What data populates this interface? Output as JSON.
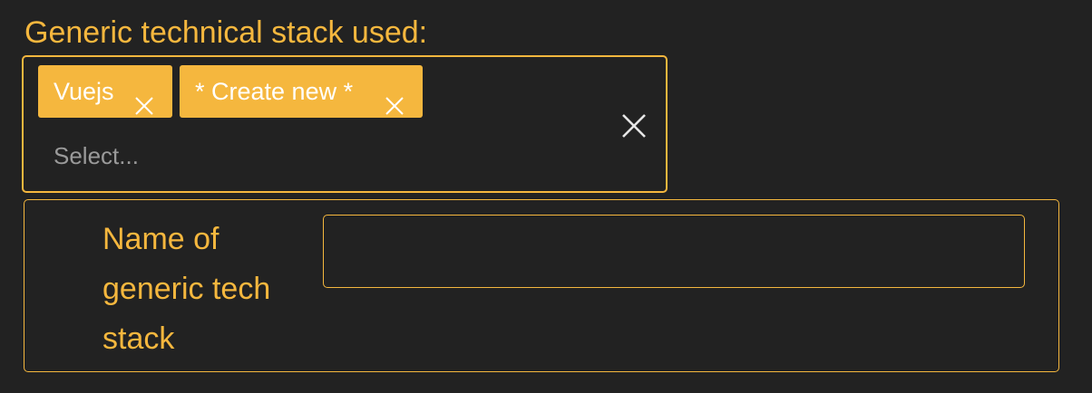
{
  "form": {
    "stack_label": "Generic technical stack used:",
    "tags": [
      {
        "label": "Vuejs",
        "remove_icon": "close-icon"
      },
      {
        "label": "* Create new *",
        "remove_icon": "close-icon"
      }
    ],
    "select_placeholder": "Select...",
    "clear_icon": "close-icon",
    "name_field": {
      "label": "Name of generic tech stack",
      "value": ""
    }
  },
  "colors": {
    "background": "#222222",
    "accent": "#f5b73e",
    "tag_text": "#ffffff",
    "placeholder": "#9a9a9a",
    "clear_icon": "#e6e6e6"
  }
}
